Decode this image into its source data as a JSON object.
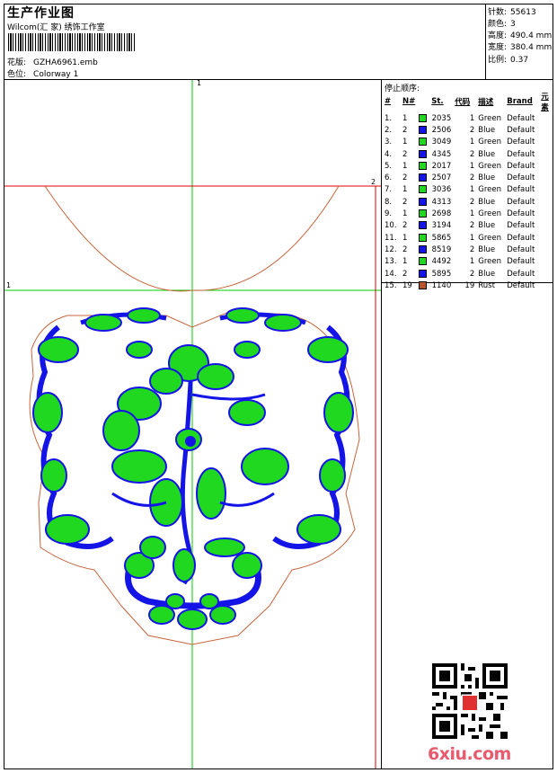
{
  "header": {
    "title": "生产作业图",
    "company": "Wilcom(汇 家) 绣饰工作室",
    "design_label": "花版:",
    "design_value": "GZHA6961.emb",
    "colorway_label": "色位:",
    "colorway_value": "Colorway 1"
  },
  "stats": [
    {
      "label": "针数:",
      "value": "55613"
    },
    {
      "label": "颜色:",
      "value": "3"
    },
    {
      "label": "高度:",
      "value": "490.4 mm"
    },
    {
      "label": "宽度:",
      "value": "380.4 mm"
    },
    {
      "label": "比例:",
      "value": "0.37"
    }
  ],
  "stop_sequence": {
    "title": "停止顺序:",
    "columns": [
      "#",
      "N#",
      "St.",
      "代码",
      "描述",
      "Brand",
      "元素"
    ],
    "rows": [
      {
        "idx": "1.",
        "n": "1",
        "code": "2035",
        "st": "1",
        "desc": "Green",
        "brand": "Default",
        "color": "#1fd81f"
      },
      {
        "idx": "2.",
        "n": "2",
        "code": "2506",
        "st": "2",
        "desc": "Blue",
        "brand": "Default",
        "color": "#1414e6"
      },
      {
        "idx": "3.",
        "n": "1",
        "code": "3049",
        "st": "1",
        "desc": "Green",
        "brand": "Default",
        "color": "#1fd81f"
      },
      {
        "idx": "4.",
        "n": "2",
        "code": "4345",
        "st": "2",
        "desc": "Blue",
        "brand": "Default",
        "color": "#1414e6"
      },
      {
        "idx": "5.",
        "n": "1",
        "code": "2017",
        "st": "1",
        "desc": "Green",
        "brand": "Default",
        "color": "#1fd81f"
      },
      {
        "idx": "6.",
        "n": "2",
        "code": "2507",
        "st": "2",
        "desc": "Blue",
        "brand": "Default",
        "color": "#1414e6"
      },
      {
        "idx": "7.",
        "n": "1",
        "code": "3036",
        "st": "1",
        "desc": "Green",
        "brand": "Default",
        "color": "#1fd81f"
      },
      {
        "idx": "8.",
        "n": "2",
        "code": "4313",
        "st": "2",
        "desc": "Blue",
        "brand": "Default",
        "color": "#1414e6"
      },
      {
        "idx": "9.",
        "n": "1",
        "code": "2698",
        "st": "1",
        "desc": "Green",
        "brand": "Default",
        "color": "#1fd81f"
      },
      {
        "idx": "10.",
        "n": "2",
        "code": "3194",
        "st": "2",
        "desc": "Blue",
        "brand": "Default",
        "color": "#1414e6"
      },
      {
        "idx": "11.",
        "n": "1",
        "code": "5865",
        "st": "1",
        "desc": "Green",
        "brand": "Default",
        "color": "#1fd81f"
      },
      {
        "idx": "12.",
        "n": "2",
        "code": "8519",
        "st": "2",
        "desc": "Blue",
        "brand": "Default",
        "color": "#1414e6"
      },
      {
        "idx": "13.",
        "n": "1",
        "code": "4492",
        "st": "1",
        "desc": "Green",
        "brand": "Default",
        "color": "#1fd81f"
      },
      {
        "idx": "14.",
        "n": "2",
        "code": "5895",
        "st": "2",
        "desc": "Blue",
        "brand": "Default",
        "color": "#1414e6"
      },
      {
        "idx": "15.",
        "n": "19",
        "code": "1140",
        "st": "19",
        "desc": "Rust",
        "brand": "Default",
        "color": "#b8552a"
      }
    ]
  },
  "guides": {
    "v_label": "1",
    "h_label_left": "1",
    "h_label_right": "2"
  },
  "footer": {
    "logo": "6xiu.com"
  },
  "colors": {
    "green": "#1fd81f",
    "blue": "#1414e6",
    "rust": "#c8643c",
    "guide_green": "#00cc00",
    "guide_red": "#dd0000"
  }
}
